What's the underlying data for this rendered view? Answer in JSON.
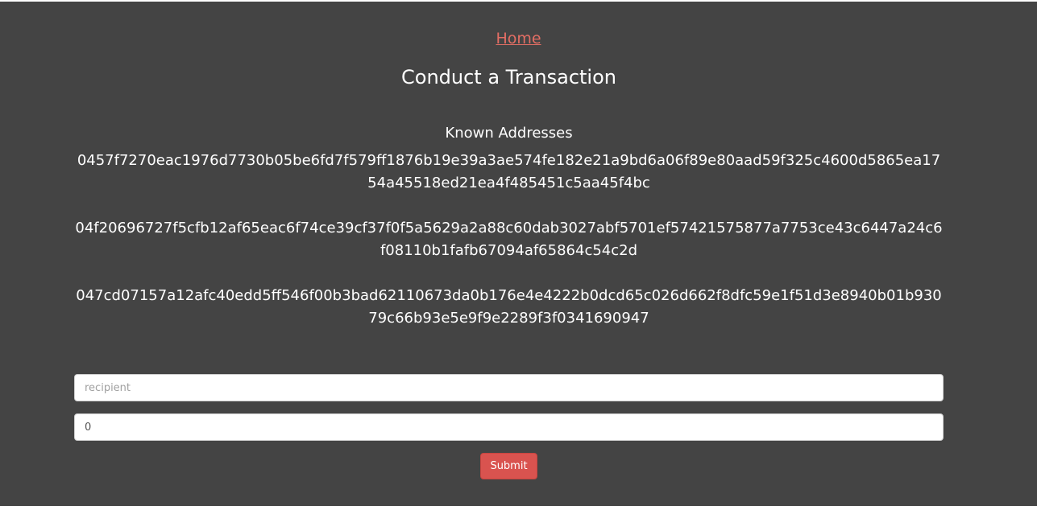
{
  "nav": {
    "home_label": "Home"
  },
  "page": {
    "title": "Conduct a Transaction",
    "known_addresses_title": "Known Addresses"
  },
  "addresses": [
    "0457f7270eac1976d7730b05be6fd7f579ff1876b19e39a3ae574fe182e21a9bd6a06f89e80aad59f325c4600d5865ea1754a45518ed21ea4f485451c5aa45f4bc",
    "04f20696727f5cfb12af65eac6f74ce39cf37f0f5a5629a2a88c60dab3027abf5701ef57421575877a7753ce43c6447a24c6f08110b1fafb67094af65864c54c2d",
    "047cd07157a12afc40edd5ff546f00b3bad62110673da0b176e4e4222b0dcd65c026d662f8dfc59e1f51d3e8940b01b93079c66b93e5e9f9e2289f3f0341690947"
  ],
  "form": {
    "recipient_placeholder": "recipient",
    "recipient_value": "",
    "amount_value": "0",
    "submit_label": "Submit"
  },
  "colors": {
    "background": "#444444",
    "link": "#e36e64",
    "submit": "#d9534f"
  }
}
